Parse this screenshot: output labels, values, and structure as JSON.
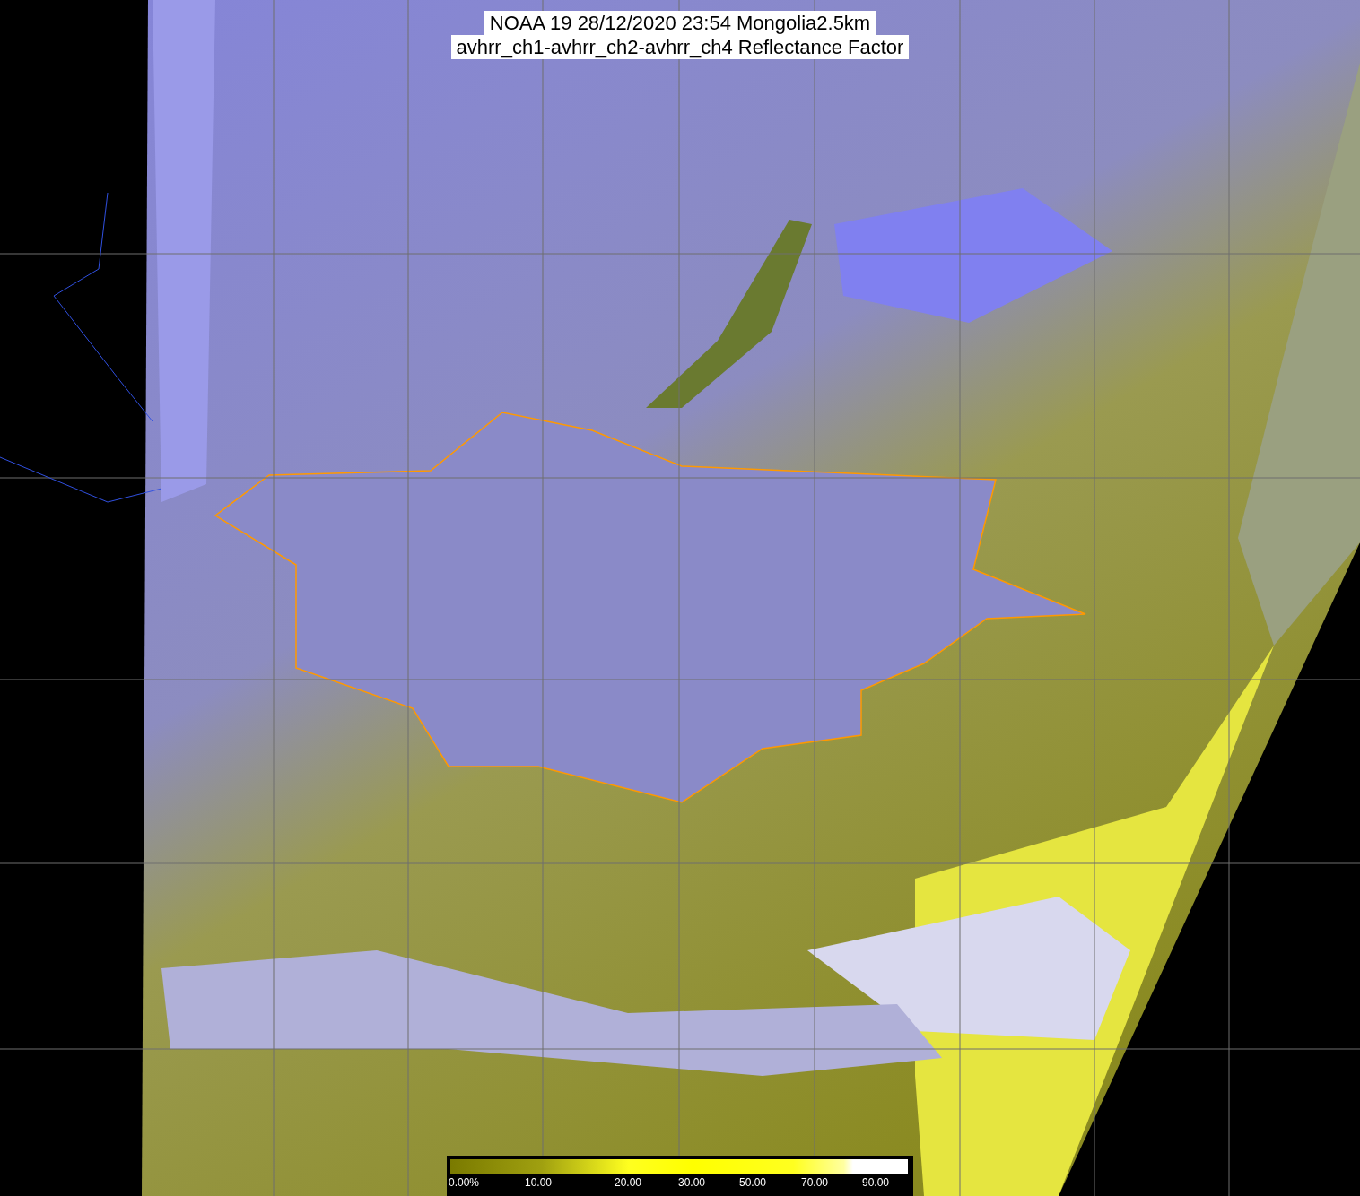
{
  "title_lines": [
    "NOAA 19 28/12/2020 23:54 Mongolia2.5km",
    "avhrr_ch1-avhrr_ch2-avhrr_ch4 Reflectance Factor"
  ],
  "colorbar": {
    "ticks": [
      "0.00%",
      "10.00",
      "20.00",
      "30.00",
      "50.00",
      "70.00",
      "90.00"
    ]
  }
}
